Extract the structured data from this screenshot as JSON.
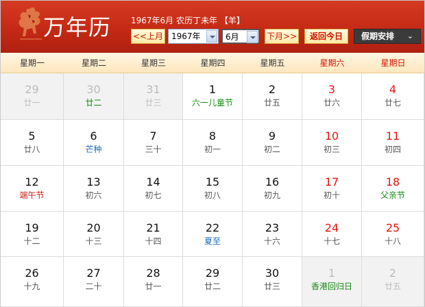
{
  "header": {
    "logo_text": "万年历",
    "lunar_prefix": "1967年6月 农历丁未年",
    "zodiac": "【羊】",
    "prev_label": "<<上月",
    "year_value": "1967年",
    "month_value": "6月",
    "next_label": "下月>>",
    "today_label": "返回今日",
    "holiday_label": "假期安排",
    "holiday_chevron": "⌄"
  },
  "weekdays": [
    "星期一",
    "星期二",
    "星期三",
    "星期四",
    "星期五",
    "星期六",
    "星期日"
  ],
  "colors": {
    "header_red": "#c42a15",
    "weekend_red": "#e8120c",
    "festival_green": "#128a12",
    "solar_term_blue": "#1e6fb8",
    "festival_red": "#d0150c",
    "other_month_bg": "#f2f2f2"
  },
  "weeks": [
    [
      {
        "day": "29",
        "sub": "廿一",
        "other": true
      },
      {
        "day": "30",
        "sub": "廿二",
        "other": true,
        "kind": "fest-green"
      },
      {
        "day": "31",
        "sub": "廿三",
        "other": true
      },
      {
        "day": "1",
        "sub": "六一儿童节",
        "kind": "fest-green"
      },
      {
        "day": "2",
        "sub": "廿五"
      },
      {
        "day": "3",
        "sub": "廿六",
        "weekend": true
      },
      {
        "day": "4",
        "sub": "廿七",
        "weekend": true
      }
    ],
    [
      {
        "day": "5",
        "sub": "廿八"
      },
      {
        "day": "6",
        "sub": "芒种",
        "kind": "fest-blue"
      },
      {
        "day": "7",
        "sub": "三十"
      },
      {
        "day": "8",
        "sub": "初一"
      },
      {
        "day": "9",
        "sub": "初二"
      },
      {
        "day": "10",
        "sub": "初三",
        "weekend": true
      },
      {
        "day": "11",
        "sub": "初四",
        "weekend": true
      }
    ],
    [
      {
        "day": "12",
        "sub": "端午节",
        "kind": "fest-red"
      },
      {
        "day": "13",
        "sub": "初六"
      },
      {
        "day": "14",
        "sub": "初七"
      },
      {
        "day": "15",
        "sub": "初八"
      },
      {
        "day": "16",
        "sub": "初九"
      },
      {
        "day": "17",
        "sub": "初十",
        "weekend": true
      },
      {
        "day": "18",
        "sub": "父亲节",
        "weekend": true,
        "kind": "fest-green"
      }
    ],
    [
      {
        "day": "19",
        "sub": "十二"
      },
      {
        "day": "20",
        "sub": "十三"
      },
      {
        "day": "21",
        "sub": "十四"
      },
      {
        "day": "22",
        "sub": "夏至",
        "kind": "fest-blue"
      },
      {
        "day": "23",
        "sub": "十六"
      },
      {
        "day": "24",
        "sub": "十七",
        "weekend": true
      },
      {
        "day": "25",
        "sub": "十八",
        "weekend": true
      }
    ],
    [
      {
        "day": "26",
        "sub": "十九"
      },
      {
        "day": "27",
        "sub": "二十"
      },
      {
        "day": "28",
        "sub": "廿一"
      },
      {
        "day": "29",
        "sub": "廿二"
      },
      {
        "day": "30",
        "sub": "廿三"
      },
      {
        "day": "1",
        "sub": "香港回归日",
        "other": true,
        "kind": "fest-green"
      },
      {
        "day": "2",
        "sub": "廿五",
        "other": true
      }
    ]
  ]
}
